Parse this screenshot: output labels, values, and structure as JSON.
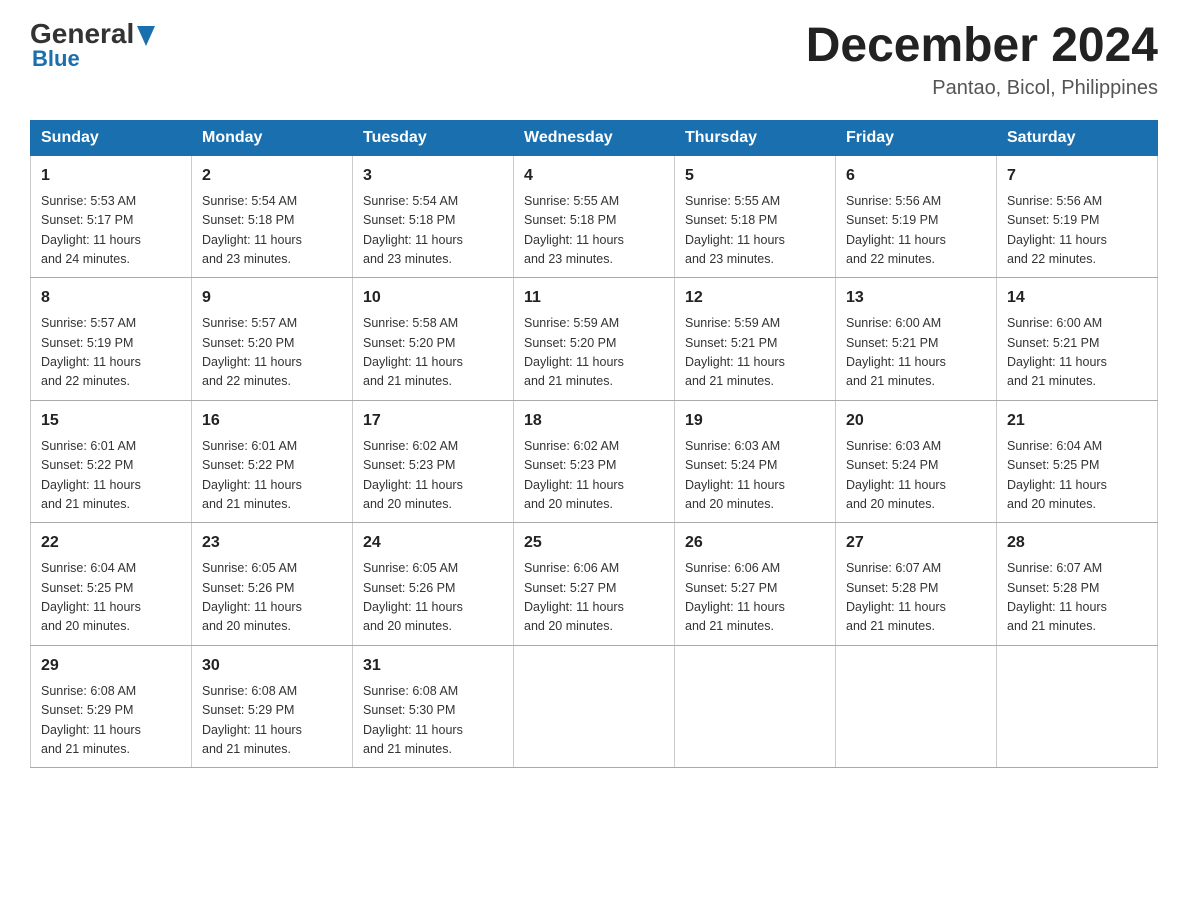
{
  "logo": {
    "part1": "General",
    "part2": "Blue"
  },
  "title": "December 2024",
  "subtitle": "Pantao, Bicol, Philippines",
  "days_of_week": [
    "Sunday",
    "Monday",
    "Tuesday",
    "Wednesday",
    "Thursday",
    "Friday",
    "Saturday"
  ],
  "weeks": [
    [
      {
        "day": "1",
        "sunrise": "5:53 AM",
        "sunset": "5:17 PM",
        "daylight": "11 hours and 24 minutes."
      },
      {
        "day": "2",
        "sunrise": "5:54 AM",
        "sunset": "5:18 PM",
        "daylight": "11 hours and 23 minutes."
      },
      {
        "day": "3",
        "sunrise": "5:54 AM",
        "sunset": "5:18 PM",
        "daylight": "11 hours and 23 minutes."
      },
      {
        "day": "4",
        "sunrise": "5:55 AM",
        "sunset": "5:18 PM",
        "daylight": "11 hours and 23 minutes."
      },
      {
        "day": "5",
        "sunrise": "5:55 AM",
        "sunset": "5:18 PM",
        "daylight": "11 hours and 23 minutes."
      },
      {
        "day": "6",
        "sunrise": "5:56 AM",
        "sunset": "5:19 PM",
        "daylight": "11 hours and 22 minutes."
      },
      {
        "day": "7",
        "sunrise": "5:56 AM",
        "sunset": "5:19 PM",
        "daylight": "11 hours and 22 minutes."
      }
    ],
    [
      {
        "day": "8",
        "sunrise": "5:57 AM",
        "sunset": "5:19 PM",
        "daylight": "11 hours and 22 minutes."
      },
      {
        "day": "9",
        "sunrise": "5:57 AM",
        "sunset": "5:20 PM",
        "daylight": "11 hours and 22 minutes."
      },
      {
        "day": "10",
        "sunrise": "5:58 AM",
        "sunset": "5:20 PM",
        "daylight": "11 hours and 21 minutes."
      },
      {
        "day": "11",
        "sunrise": "5:59 AM",
        "sunset": "5:20 PM",
        "daylight": "11 hours and 21 minutes."
      },
      {
        "day": "12",
        "sunrise": "5:59 AM",
        "sunset": "5:21 PM",
        "daylight": "11 hours and 21 minutes."
      },
      {
        "day": "13",
        "sunrise": "6:00 AM",
        "sunset": "5:21 PM",
        "daylight": "11 hours and 21 minutes."
      },
      {
        "day": "14",
        "sunrise": "6:00 AM",
        "sunset": "5:21 PM",
        "daylight": "11 hours and 21 minutes."
      }
    ],
    [
      {
        "day": "15",
        "sunrise": "6:01 AM",
        "sunset": "5:22 PM",
        "daylight": "11 hours and 21 minutes."
      },
      {
        "day": "16",
        "sunrise": "6:01 AM",
        "sunset": "5:22 PM",
        "daylight": "11 hours and 21 minutes."
      },
      {
        "day": "17",
        "sunrise": "6:02 AM",
        "sunset": "5:23 PM",
        "daylight": "11 hours and 20 minutes."
      },
      {
        "day": "18",
        "sunrise": "6:02 AM",
        "sunset": "5:23 PM",
        "daylight": "11 hours and 20 minutes."
      },
      {
        "day": "19",
        "sunrise": "6:03 AM",
        "sunset": "5:24 PM",
        "daylight": "11 hours and 20 minutes."
      },
      {
        "day": "20",
        "sunrise": "6:03 AM",
        "sunset": "5:24 PM",
        "daylight": "11 hours and 20 minutes."
      },
      {
        "day": "21",
        "sunrise": "6:04 AM",
        "sunset": "5:25 PM",
        "daylight": "11 hours and 20 minutes."
      }
    ],
    [
      {
        "day": "22",
        "sunrise": "6:04 AM",
        "sunset": "5:25 PM",
        "daylight": "11 hours and 20 minutes."
      },
      {
        "day": "23",
        "sunrise": "6:05 AM",
        "sunset": "5:26 PM",
        "daylight": "11 hours and 20 minutes."
      },
      {
        "day": "24",
        "sunrise": "6:05 AM",
        "sunset": "5:26 PM",
        "daylight": "11 hours and 20 minutes."
      },
      {
        "day": "25",
        "sunrise": "6:06 AM",
        "sunset": "5:27 PM",
        "daylight": "11 hours and 20 minutes."
      },
      {
        "day": "26",
        "sunrise": "6:06 AM",
        "sunset": "5:27 PM",
        "daylight": "11 hours and 21 minutes."
      },
      {
        "day": "27",
        "sunrise": "6:07 AM",
        "sunset": "5:28 PM",
        "daylight": "11 hours and 21 minutes."
      },
      {
        "day": "28",
        "sunrise": "6:07 AM",
        "sunset": "5:28 PM",
        "daylight": "11 hours and 21 minutes."
      }
    ],
    [
      {
        "day": "29",
        "sunrise": "6:08 AM",
        "sunset": "5:29 PM",
        "daylight": "11 hours and 21 minutes."
      },
      {
        "day": "30",
        "sunrise": "6:08 AM",
        "sunset": "5:29 PM",
        "daylight": "11 hours and 21 minutes."
      },
      {
        "day": "31",
        "sunrise": "6:08 AM",
        "sunset": "5:30 PM",
        "daylight": "11 hours and 21 minutes."
      },
      null,
      null,
      null,
      null
    ]
  ],
  "labels": {
    "sunrise": "Sunrise:",
    "sunset": "Sunset:",
    "daylight": "Daylight:"
  }
}
